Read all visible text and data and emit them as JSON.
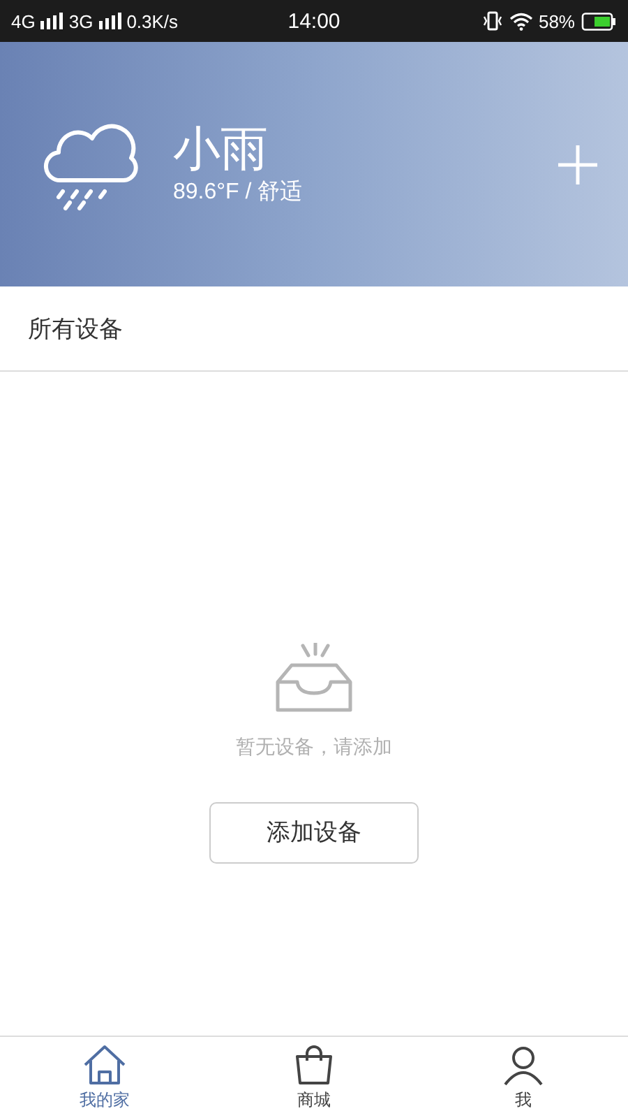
{
  "status_bar": {
    "network_1": "4G",
    "network_2": "3G",
    "speed": "0.3K/s",
    "time": "14:00",
    "battery": "58%"
  },
  "weather": {
    "condition": "小雨",
    "detail": "89.6°F / 舒适"
  },
  "section": {
    "title": "所有设备"
  },
  "empty_state": {
    "message": "暂无设备，请添加",
    "button": "添加设备"
  },
  "tabs": [
    {
      "label": "我的家",
      "kind": "home",
      "selected": true
    },
    {
      "label": "商城",
      "kind": "shop",
      "selected": false
    },
    {
      "label": "我",
      "kind": "me",
      "selected": false
    }
  ]
}
